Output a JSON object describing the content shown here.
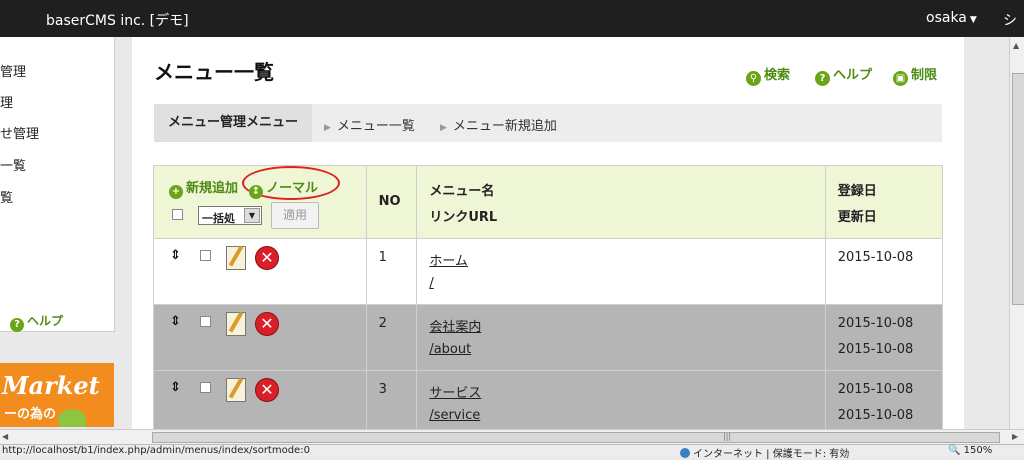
{
  "topbar": {
    "site": "baserCMS inc. [デモ]",
    "user": "osaka",
    "more": "シ"
  },
  "sidebar": {
    "items": [
      "管理",
      "理",
      "せ管理",
      "一覧",
      "覧"
    ],
    "help": "ヘルプ"
  },
  "banner": {
    "line1": "Market",
    "line2": "ーの為の"
  },
  "page": {
    "title": "メニュー一覧",
    "links": {
      "search": "検索",
      "help": "ヘルプ",
      "restrict": "制限"
    }
  },
  "breadcrumb": [
    "メニュー管理メニュー",
    "メニュー一覧",
    "メニュー新規追加"
  ],
  "table": {
    "add_label": "新規追加",
    "normal_label": "ノーマル",
    "bulk_select": "一括処",
    "apply_label": "適用",
    "headers": {
      "no": "NO",
      "name": "メニュー名",
      "url": "リンクURL",
      "created": "登録日",
      "updated": "更新日"
    },
    "rows": [
      {
        "no": "1",
        "name": "ホーム",
        "url": "/",
        "created": "2015-10-08",
        "updated": ""
      },
      {
        "no": "2",
        "name": "会社案内",
        "url": "/about",
        "created": "2015-10-08",
        "updated": "2015-10-08"
      },
      {
        "no": "3",
        "name": "サービス",
        "url": "/service",
        "created": "2015-10-08",
        "updated": "2015-10-08"
      }
    ]
  },
  "statusbar": {
    "url": "http://localhost/b1/index.php/admin/menus/index/sortmode:0",
    "zone": "インターネット | 保護モード: 有効",
    "zoom": "150%"
  },
  "colors": {
    "accent_green": "#4e8b12",
    "highlight_red": "#e02020",
    "header_bg": "#eef6d6",
    "row_grey": "#b5b5b5"
  }
}
